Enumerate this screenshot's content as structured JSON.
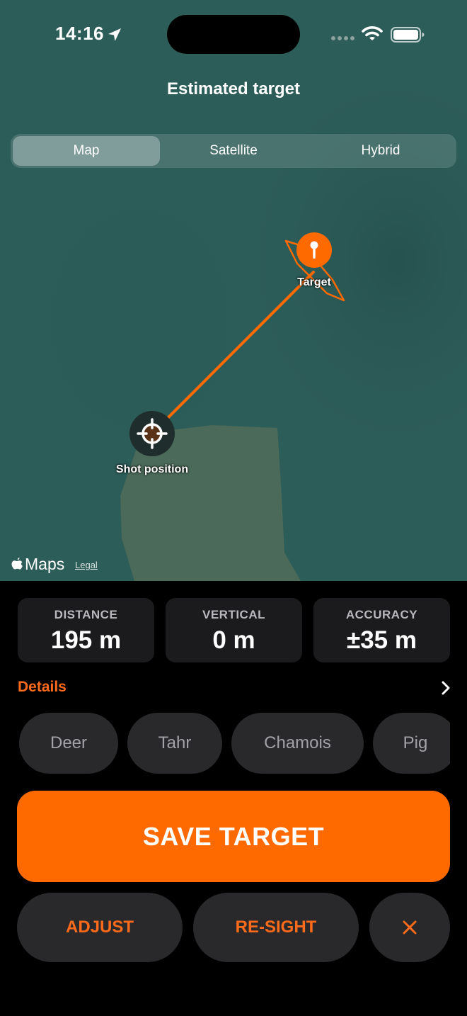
{
  "status_bar": {
    "time": "14:16"
  },
  "header": {
    "title": "Estimated target"
  },
  "map_type": {
    "options": [
      "Map",
      "Satellite",
      "Hybrid"
    ],
    "selected": "Map"
  },
  "map": {
    "target_label": "Target",
    "shot_label": "Shot position",
    "attribution": "Maps",
    "legal": "Legal"
  },
  "stats": [
    {
      "label": "DISTANCE",
      "value": "195 m"
    },
    {
      "label": "VERTICAL",
      "value": "0 m"
    },
    {
      "label": "ACCURACY",
      "value": "±35 m"
    }
  ],
  "details": {
    "label": "Details"
  },
  "species": [
    "Deer",
    "Tahr",
    "Chamois",
    "Pig"
  ],
  "actions": {
    "save": "SAVE TARGET",
    "adjust": "ADJUST",
    "resight": "RE-SIGHT"
  },
  "colors": {
    "accent": "#ff6a00",
    "map_water": "#2c5c58",
    "map_land": "#4d6a5a",
    "card_bg": "#1b1b1d",
    "chip_bg": "#29292c"
  },
  "icons": [
    "location-arrow-icon",
    "signal-icon",
    "wifi-icon",
    "battery-icon",
    "target-pin-icon",
    "crosshair-icon",
    "apple-icon",
    "chevron-right-icon",
    "close-icon"
  ]
}
